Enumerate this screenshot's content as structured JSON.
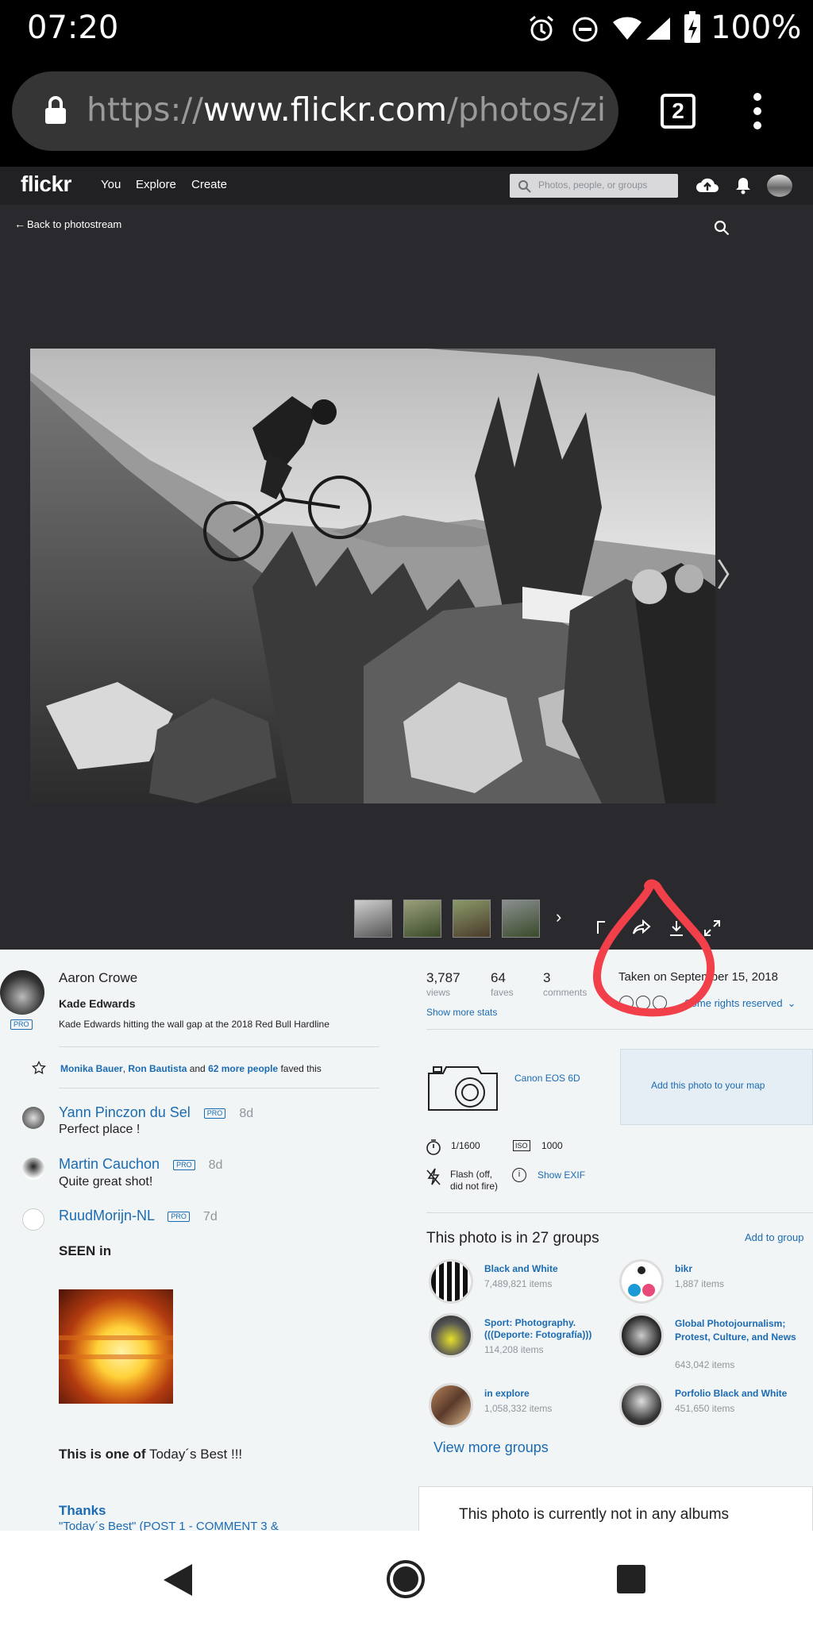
{
  "status": {
    "time": "07:20",
    "battery": "100%"
  },
  "browser": {
    "url_scheme": "https://",
    "url_host": "www.flickr.com",
    "url_path": "/photos/zi",
    "tab_count": "2"
  },
  "flickr_nav": {
    "logo": "flickr",
    "links": [
      "You",
      "Explore",
      "Create"
    ],
    "search_placeholder": "Photos, people, or groups"
  },
  "photo_page": {
    "back_label": "Back to photostream"
  },
  "owner": {
    "name": "Aaron Crowe",
    "pro": "PRO",
    "title": "Kade Edwards",
    "description": "Kade Edwards hitting the wall gap at the 2018 Red Bull Hardline"
  },
  "faves": {
    "name1": "Monika Bauer",
    "sep": ", ",
    "name2": "Ron Bautista",
    "and": " and ",
    "more": "62 more people",
    "suffix": " faved this"
  },
  "comments": [
    {
      "author": "Yann Pinczon du Sel",
      "pro": "PRO",
      "age": "8d",
      "text": "Perfect place !"
    },
    {
      "author": "Martin Cauchon",
      "pro": "PRO",
      "age": "8d",
      "text": "Quite great shot!"
    },
    {
      "author": "RuudMorijn-NL",
      "pro": "PRO",
      "age": "7d",
      "seen": "SEEN in",
      "best_bold": "This is one of",
      "best_rest": " Today´s Best !!!",
      "thanks": "Thanks",
      "thanks2": "\"Today´s Best\" (POST 1 - COMMENT 3 &"
    }
  ],
  "stats": [
    {
      "value": "3,787",
      "label": "views"
    },
    {
      "value": "64",
      "label": "faves"
    },
    {
      "value": "3",
      "label": "comments"
    }
  ],
  "taken_on": "Taken on September 15, 2018",
  "show_more_stats": "Show more stats",
  "license": "Some rights reserved",
  "camera": "Canon EOS 6D",
  "map_label": "Add this photo to your map",
  "exif": {
    "shutter": "1/1600",
    "iso_label": "ISO",
    "iso": "1000",
    "flash": "Flash (off, did not fire)",
    "show_exif": "Show EXIF"
  },
  "groups_heading": "This photo is in 27 groups",
  "add_to_group": "Add to group",
  "groups": [
    {
      "name": "Black and White",
      "items": "7,489,821 items"
    },
    {
      "name": "bikr",
      "items": "1,887 items"
    },
    {
      "name": "Sport: Photography. (((Deporte: Fotografía)))",
      "items": "114,208 items"
    },
    {
      "name": "Global Photojournalism; Protest, Culture, and News",
      "items": "643,042 items"
    },
    {
      "name": "in explore",
      "items": "1,058,332 items"
    },
    {
      "name": "Porfolio Black and White",
      "items": "451,650 items"
    }
  ],
  "view_more_groups": "View more groups",
  "albums_text": "This photo is currently not in any albums",
  "colors": {
    "flickr_dark": "#212124",
    "photo_bg": "#2a2a2e",
    "link_blue": "#1b6bb3",
    "annotation_red": "#f2404a"
  }
}
